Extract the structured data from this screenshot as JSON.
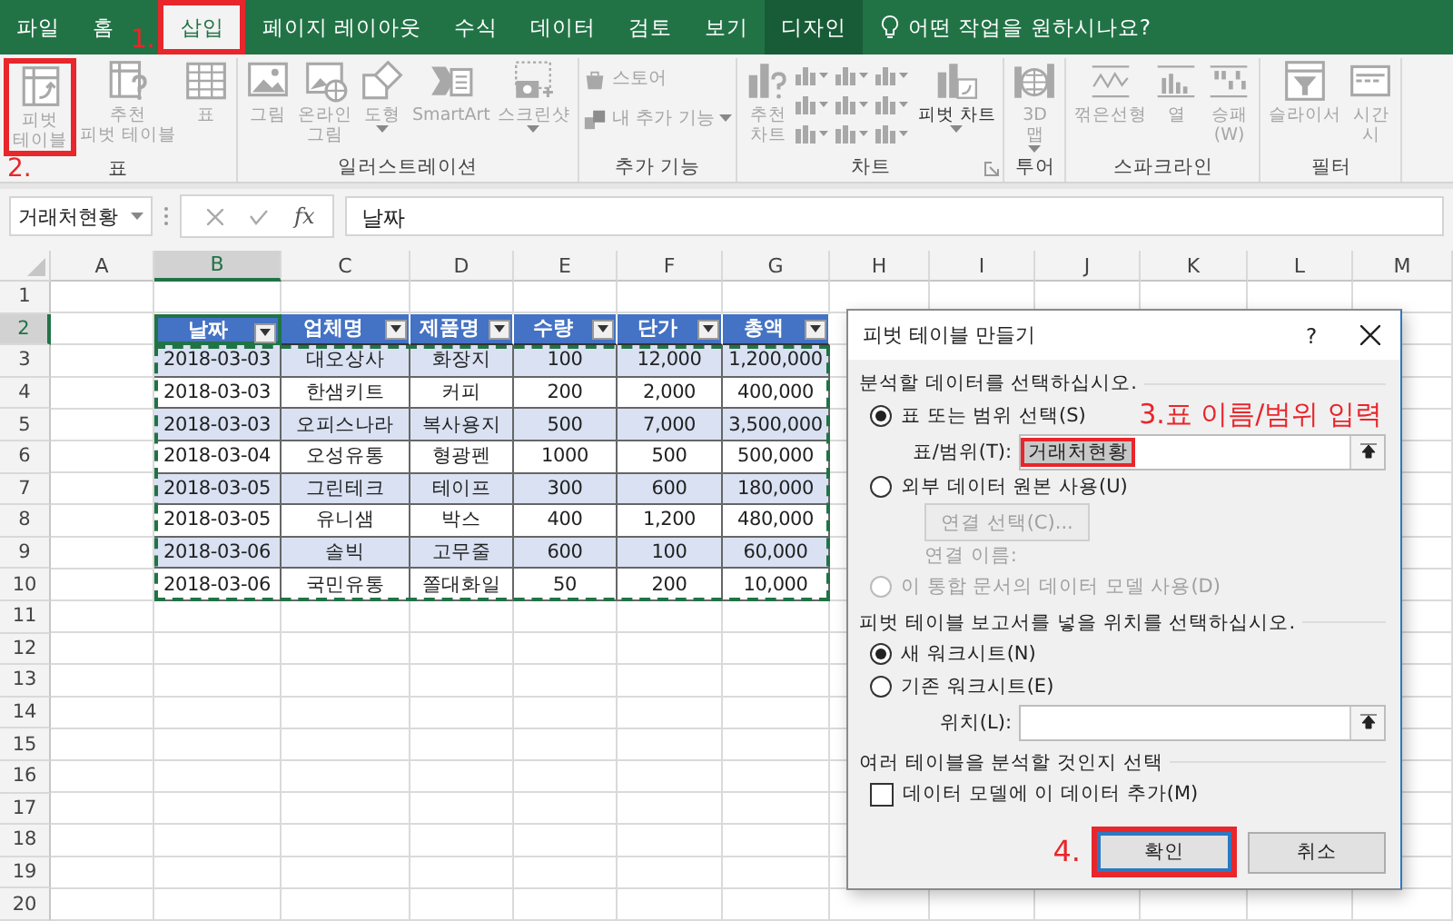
{
  "tabs": [
    {
      "label": "파일",
      "selected": false,
      "contextual": false,
      "highlighted": false
    },
    {
      "label": "홈",
      "selected": false,
      "contextual": false,
      "highlighted": false
    },
    {
      "label": "삽입",
      "selected": true,
      "contextual": false,
      "highlighted": true
    },
    {
      "label": "페이지 레이아웃",
      "selected": false,
      "contextual": false,
      "highlighted": false
    },
    {
      "label": "수식",
      "selected": false,
      "contextual": false,
      "highlighted": false
    },
    {
      "label": "데이터",
      "selected": false,
      "contextual": false,
      "highlighted": false
    },
    {
      "label": "검토",
      "selected": false,
      "contextual": false,
      "highlighted": false
    },
    {
      "label": "보기",
      "selected": false,
      "contextual": false,
      "highlighted": false
    },
    {
      "label": "디자인",
      "selected": false,
      "contextual": true,
      "highlighted": false
    }
  ],
  "tab_annotation": "1.",
  "tell_me": "어떤 작업을 원하시나요?",
  "ribbon_annotation": "2.",
  "ribbon_groups": [
    {
      "label": "표",
      "items": [
        {
          "kind": "large",
          "label": "피벗\n테이블",
          "disabled": true,
          "highlighted": true,
          "dropdown": false
        },
        {
          "kind": "large",
          "label": "추천\n피벗 테이블",
          "disabled": true,
          "highlighted": false,
          "dropdown": false
        },
        {
          "kind": "large",
          "label": "표",
          "disabled": true,
          "highlighted": false,
          "dropdown": false
        }
      ]
    },
    {
      "label": "일러스트레이션",
      "items": [
        {
          "kind": "large",
          "label": "그림",
          "disabled": true,
          "highlighted": false,
          "dropdown": false
        },
        {
          "kind": "large",
          "label": "온라인\n그림",
          "disabled": true,
          "highlighted": false,
          "dropdown": false
        },
        {
          "kind": "large",
          "label": "도형",
          "disabled": true,
          "highlighted": false,
          "dropdown": true
        },
        {
          "kind": "large",
          "label": "SmartArt",
          "disabled": true,
          "highlighted": false,
          "dropdown": false
        },
        {
          "kind": "large",
          "label": "스크린샷",
          "disabled": true,
          "highlighted": false,
          "dropdown": true
        }
      ]
    },
    {
      "label": "추가 기능",
      "items": [
        {
          "kind": "small",
          "label": "스토어",
          "disabled": true,
          "dropdown": false
        },
        {
          "kind": "small",
          "label": "내 추가 기능",
          "disabled": true,
          "dropdown": true
        }
      ]
    },
    {
      "label": "차트",
      "launcher": true,
      "items": [
        {
          "kind": "large",
          "label": "추천\n차트",
          "disabled": true,
          "highlighted": false,
          "dropdown": false
        },
        {
          "kind": "gallery"
        },
        {
          "kind": "large",
          "label": "피벗 차트",
          "disabled": false,
          "highlighted": false,
          "dropdown": true
        }
      ]
    },
    {
      "label": "투어",
      "items": [
        {
          "kind": "large",
          "label": "3D\n맵",
          "disabled": true,
          "highlighted": false,
          "dropdown": true
        }
      ]
    },
    {
      "label": "스파크라인",
      "items": [
        {
          "kind": "large",
          "label": "꺾은선형",
          "disabled": true,
          "highlighted": false,
          "dropdown": false
        },
        {
          "kind": "large",
          "label": "열",
          "disabled": true,
          "highlighted": false,
          "dropdown": false
        },
        {
          "kind": "large",
          "label": "승패\n(W)",
          "disabled": true,
          "highlighted": false,
          "dropdown": false
        }
      ]
    },
    {
      "label": "필터",
      "items": [
        {
          "kind": "large",
          "label": "슬라이서",
          "disabled": true,
          "highlighted": false,
          "dropdown": false
        },
        {
          "kind": "large",
          "label": "시간\n시",
          "disabled": true,
          "highlighted": false,
          "dropdown": false
        }
      ]
    }
  ],
  "formula_bar": {
    "name_box": "거래처현황",
    "function_label": "fx",
    "value": "날짜"
  },
  "sheet": {
    "columns": [
      {
        "label": "A",
        "selected": false
      },
      {
        "label": "B",
        "selected": true
      },
      {
        "label": "C",
        "selected": false
      },
      {
        "label": "D",
        "selected": false
      },
      {
        "label": "E",
        "selected": false
      },
      {
        "label": "F",
        "selected": false
      },
      {
        "label": "G",
        "selected": false
      },
      {
        "label": "H",
        "selected": false
      },
      {
        "label": "I",
        "selected": false
      },
      {
        "label": "J",
        "selected": false
      },
      {
        "label": "K",
        "selected": false
      },
      {
        "label": "L",
        "selected": false
      },
      {
        "label": "M",
        "selected": false
      }
    ],
    "rows": [
      {
        "label": "1",
        "selected": false
      },
      {
        "label": "2",
        "selected": true
      },
      {
        "label": "3",
        "selected": false
      },
      {
        "label": "4",
        "selected": false
      },
      {
        "label": "5",
        "selected": false
      },
      {
        "label": "6",
        "selected": false
      },
      {
        "label": "7",
        "selected": false
      },
      {
        "label": "8",
        "selected": false
      },
      {
        "label": "9",
        "selected": false
      },
      {
        "label": "10",
        "selected": false
      },
      {
        "label": "11",
        "selected": false
      },
      {
        "label": "12",
        "selected": false
      },
      {
        "label": "13",
        "selected": false
      },
      {
        "label": "14",
        "selected": false
      },
      {
        "label": "15",
        "selected": false
      },
      {
        "label": "16",
        "selected": false
      },
      {
        "label": "17",
        "selected": false
      },
      {
        "label": "18",
        "selected": false
      },
      {
        "label": "19",
        "selected": false
      },
      {
        "label": "20",
        "selected": false
      }
    ],
    "table": {
      "headers": [
        "날짜",
        "업체명",
        "제품명",
        "수량",
        "단가",
        "총액"
      ],
      "rows": [
        [
          "2018-03-03",
          "대오상사",
          "화장지",
          "100",
          "12,000",
          "1,200,000"
        ],
        [
          "2018-03-03",
          "한샘키트",
          "커피",
          "200",
          "2,000",
          "400,000"
        ],
        [
          "2018-03-03",
          "오피스나라",
          "복사용지",
          "500",
          "7,000",
          "3,500,000"
        ],
        [
          "2018-03-04",
          "오성유통",
          "형광펜",
          "1000",
          "500",
          "500,000"
        ],
        [
          "2018-03-05",
          "그린테크",
          "테이프",
          "300",
          "600",
          "180,000"
        ],
        [
          "2018-03-05",
          "유니샘",
          "박스",
          "400",
          "1,200",
          "480,000"
        ],
        [
          "2018-03-06",
          "솔빅",
          "고무줄",
          "600",
          "100",
          "60,000"
        ],
        [
          "2018-03-06",
          "국민유통",
          "쫄대화일",
          "50",
          "200",
          "10,000"
        ]
      ]
    }
  },
  "dialog": {
    "title": "피벗 테이블 만들기",
    "help": "?",
    "sections": [
      {
        "heading": "분석할 데이터를 선택하십시오.",
        "options": [
          {
            "kind": "radio",
            "label": "표 또는 범위 선택(S)",
            "selected": true,
            "disabled": false,
            "annotation": "3.표 이름/범위 입력"
          },
          {
            "kind": "field",
            "label": "표/범위(T):",
            "value": "거래처현황",
            "highlighted": true
          },
          {
            "kind": "radio",
            "label": "외부 데이터 원본 사용(U)",
            "selected": false,
            "disabled": false
          },
          {
            "kind": "button",
            "label": "연결 선택(C)...",
            "disabled": true
          },
          {
            "kind": "note",
            "label": "연결 이름:",
            "disabled": true
          },
          {
            "kind": "radio",
            "label": "이 통합 문서의 데이터 모델 사용(D)",
            "selected": false,
            "disabled": true
          }
        ]
      },
      {
        "heading": "피벗 테이블 보고서를 넣을 위치를 선택하십시오.",
        "options": [
          {
            "kind": "radio",
            "label": "새 워크시트(N)",
            "selected": true,
            "disabled": false
          },
          {
            "kind": "radio",
            "label": "기존 워크시트(E)",
            "selected": false,
            "disabled": false
          },
          {
            "kind": "field",
            "label": "위치(L):"
          }
        ]
      },
      {
        "heading": "여러 테이블을 분석할 것인지 선택",
        "options": [
          {
            "kind": "checkbox",
            "label": "데이터 모델에 이 데이터 추가(M)",
            "checked": false
          }
        ]
      }
    ],
    "button_annotation": "4.",
    "buttons": [
      {
        "label": "확인",
        "default": true,
        "highlighted": true
      },
      {
        "label": "취소",
        "default": false,
        "highlighted": false
      }
    ]
  }
}
